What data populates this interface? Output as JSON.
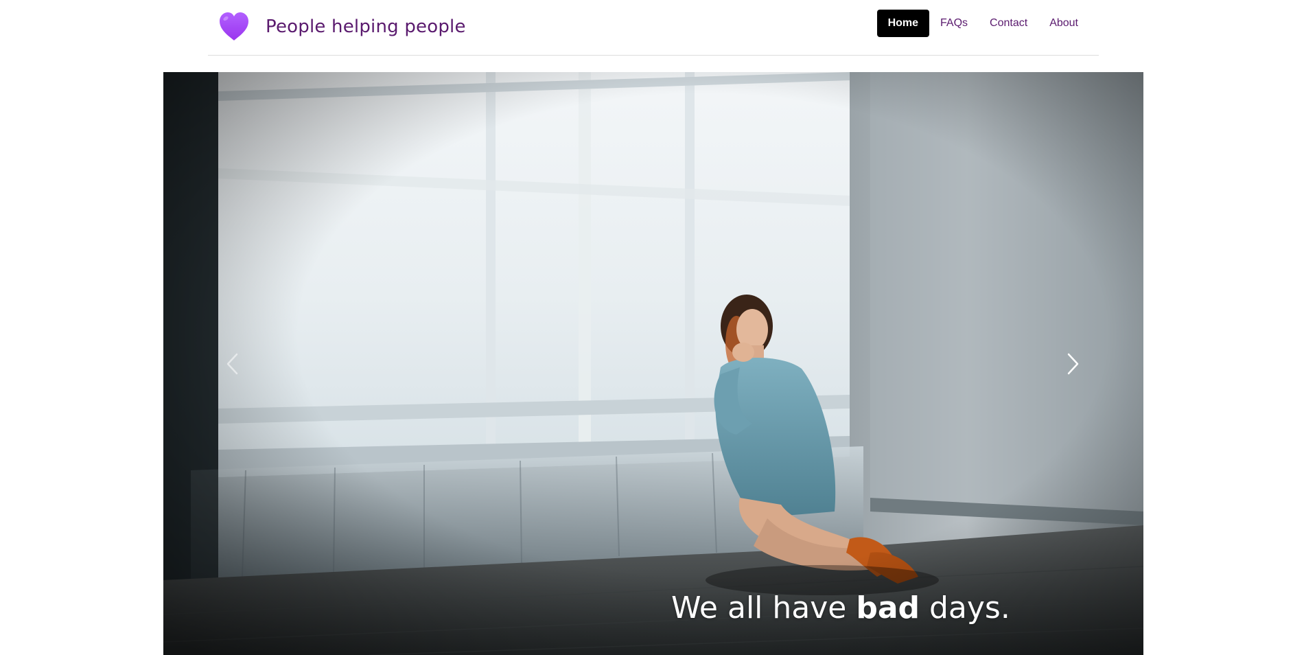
{
  "brand": {
    "title": "People helping people",
    "icon": "heart-icon",
    "icon_color": "#a64bf4"
  },
  "nav": {
    "items": [
      {
        "label": "Home",
        "active": true
      },
      {
        "label": "FAQs",
        "active": false
      },
      {
        "label": "Contact",
        "active": false
      },
      {
        "label": "About",
        "active": false
      }
    ]
  },
  "carousel": {
    "prev_icon": "chevron-left-icon",
    "next_icon": "chevron-right-icon",
    "caption": {
      "before": "We all have ",
      "emphasis": "bad",
      "after": " days."
    }
  },
  "colors": {
    "brand_text": "#5a1a6e",
    "active_nav_bg": "#000000",
    "active_nav_text": "#ffffff"
  }
}
